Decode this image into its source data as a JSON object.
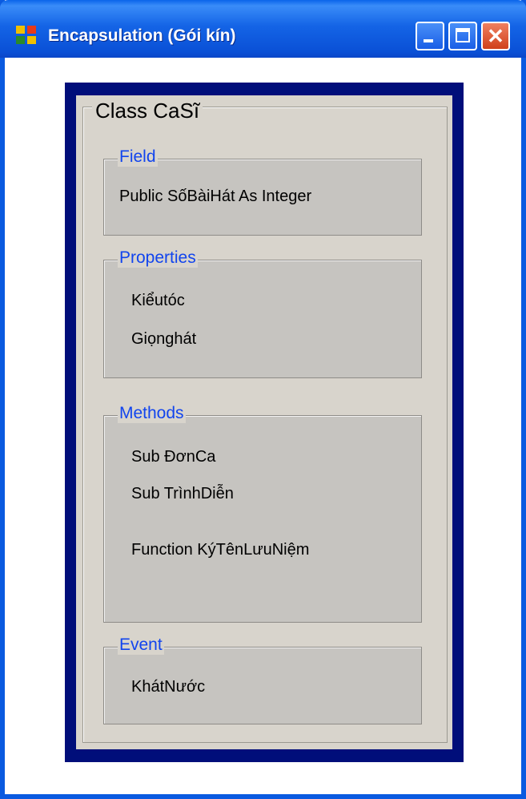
{
  "window": {
    "title": "Encapsulation (Gói kín)",
    "controls": {
      "minimize": "_",
      "maximize": "□",
      "close": "✕"
    }
  },
  "class_panel": {
    "title": "Class CaSĩ",
    "field": {
      "title": "Field",
      "items": [
        "Public SốBàiHát As Integer"
      ]
    },
    "properties": {
      "title": "Properties",
      "items": [
        "Kiểutóc",
        "Giọnghát"
      ]
    },
    "methods": {
      "title": "Methods",
      "items": [
        "Sub ĐơnCa",
        "Sub TrìnhDiễn",
        "Function  KýTênLưuNiệm"
      ]
    },
    "event": {
      "title": "Event",
      "items": [
        "KhátNước"
      ]
    }
  },
  "colors": {
    "titlebar": "#0a5ae0",
    "panel_border": "#000e7a",
    "panel_bg": "#d8d4cc",
    "group_bg": "#c6c4c0",
    "group_title": "#1144ee"
  },
  "icons": {
    "app": "app-icon",
    "minimize": "minimize-icon",
    "maximize": "maximize-icon",
    "close": "close-icon"
  }
}
